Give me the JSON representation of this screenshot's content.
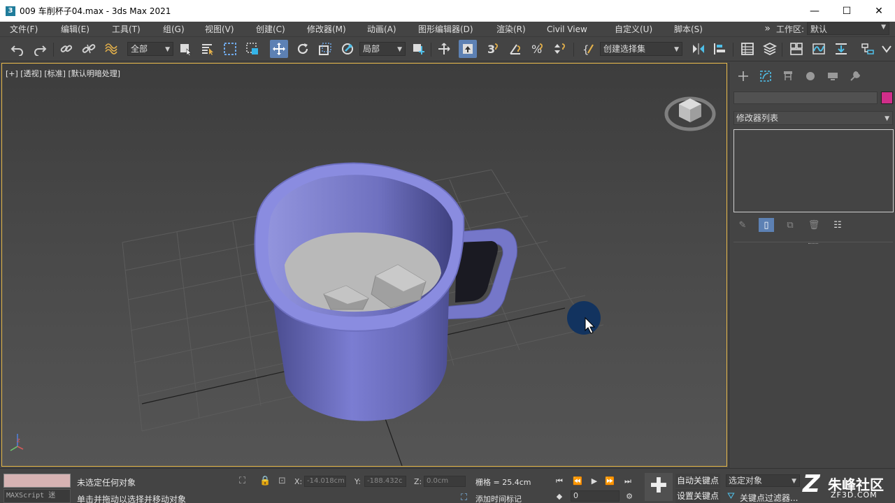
{
  "window": {
    "icon_letter": "3",
    "title": "009 车削杯子04.max - 3ds Max 2021",
    "minimize": "—",
    "maximize": "☐",
    "close": "✕"
  },
  "menu": {
    "items": [
      "文件(F)",
      "编辑(E)",
      "工具(T)",
      "组(G)",
      "视图(V)",
      "创建(C)",
      "修改器(M)",
      "动画(A)",
      "图形编辑器(D)",
      "渲染(R)",
      "Civil View",
      "自定义(U)",
      "脚本(S)"
    ],
    "workspace_chevron": "»",
    "workspace_label": "工作区:",
    "workspace_value": "默认"
  },
  "toolbar": {
    "selection_filter": "全部",
    "reference_coord": "局部",
    "named_selection": "创建选择集"
  },
  "viewport": {
    "label": "[+] [透视] [标准] [默认明暗处理]",
    "mug_color": "#7d7fd6",
    "cursor_highlight": "#12335f"
  },
  "command_panel": {
    "object_color": "#d12e8a",
    "modifier_list": "修改器列表"
  },
  "status": {
    "maxscript": "MAXScript 迷",
    "message_top": "未选定任何对象",
    "message_bottom": "单击并拖动以选择并移动对象",
    "x_label": "X:",
    "x_value": "-14.018cm",
    "y_label": "Y:",
    "y_value": "-188.432c",
    "z_label": "Z:",
    "z_value": "0.0cm",
    "grid": "栅格 = 25.4cm",
    "add_time_tag": "添加时间标记",
    "frame": "0",
    "auto_key": "自动关键点",
    "set_key": "设置关键点",
    "selected_object": "选定对象",
    "key_filters": "关键点过滤器..."
  },
  "watermark": {
    "logo": "Z",
    "name": "朱峰社区",
    "url": "ZF3D.COM"
  }
}
